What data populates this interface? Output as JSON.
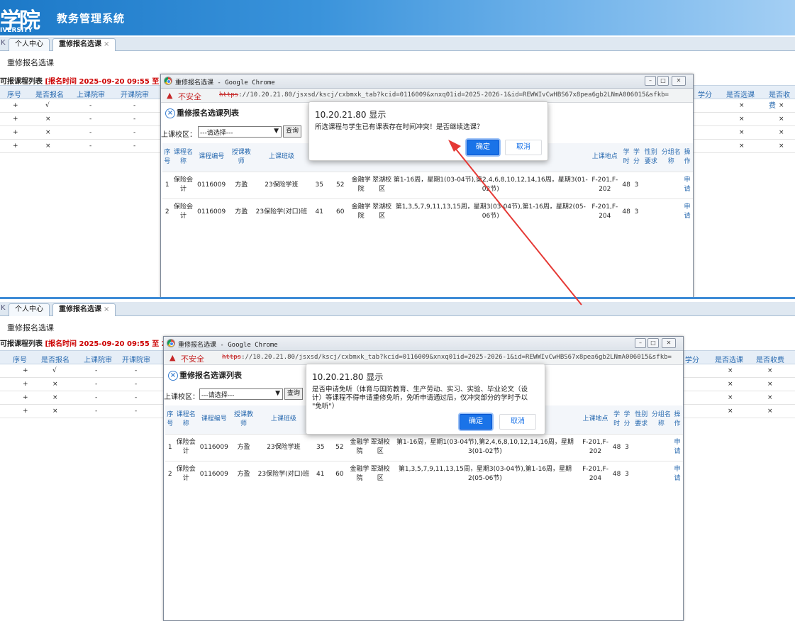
{
  "header": {
    "logo": "学院",
    "logo_sub": "IVERSITY",
    "system_title": "教务管理系统"
  },
  "tabs": {
    "arrow": "K",
    "personal": "个人中心",
    "current": "重修报名选课",
    "close": "×"
  },
  "page": {
    "section_title": "重修报名选课",
    "list_label": "可报课程列表",
    "time_label": "[报名时间 2025-09-20 09:55 至 2025"
  },
  "grid": {
    "headers_left": [
      "序号",
      "是否报名",
      "上课院审",
      "开课院审"
    ],
    "headers_right": [
      "学分",
      "是否选课",
      "是否收费"
    ],
    "rows": [
      {
        "no": "+",
        "apply": "√",
        "a": "-",
        "b": "-",
        "sel": "×",
        "fee": "×"
      },
      {
        "no": "+",
        "apply": "×",
        "a": "-",
        "b": "-",
        "sel": "×",
        "fee": "×"
      },
      {
        "no": "+",
        "apply": "×",
        "a": "-",
        "b": "-",
        "sel": "×",
        "fee": "×"
      },
      {
        "no": "+",
        "apply": "×",
        "a": "-",
        "b": "-",
        "sel": "×",
        "fee": "×"
      }
    ]
  },
  "popup": {
    "window_title": "重修报名选课 - Google Chrome",
    "insecure": "不安全",
    "url_proto": "https",
    "url_rest": "://10.20.21.80/jsxsd/kscj/cxbmxk_tab?kcid=0116009&xnxq01id=2025-2026-1&id=REWWIvCwHBS67x8pea6gb2LNmA006015&sfkb=",
    "list_title": "重修报名选课列表",
    "campus_label": "上课校区：",
    "campus_select": "---请选择---",
    "query_button": "查询",
    "minimize": "–",
    "maximize": "□",
    "close": "✕",
    "headers": {
      "seq": "序号",
      "name": "课程名称",
      "code": "课程编号",
      "teacher": "授课教师",
      "class": "上课班级",
      "col_a": "上课",
      "col_b": "数",
      "col_c": "数",
      "col_d": "系",
      "col_e": "区",
      "location": "上课地点",
      "hours": "学时",
      "credit": "学分",
      "gender": "性别要求",
      "group": "分组名称",
      "op": "操作"
    },
    "rows": [
      {
        "seq": "1",
        "name": "保险会计",
        "code": "0116009",
        "teacher": "方盈",
        "class": "23保险学班",
        "n1": "35",
        "n2": "52",
        "dept": "金融学院",
        "campus": "翠湖校区",
        "time": "第1-16周，星期1(03-04节),第2,4,6,8,10,12,14,16周，星期3(01-02节)",
        "loc": "F-201,F-202",
        "hours": "48",
        "credit": "3",
        "op": "申请"
      },
      {
        "seq": "2",
        "name": "保险会计",
        "code": "0116009",
        "teacher": "方盈",
        "class": "23保险学(对口)班",
        "n1": "41",
        "n2": "60",
        "dept": "金融学院",
        "campus": "翠湖校区",
        "time": "第1,3,5,7,9,11,13,15周，星期3(03-04节),第1-16周，星期2(05-06节)",
        "loc": "F-201,F-204",
        "hours": "48",
        "credit": "3",
        "op": "申请"
      }
    ]
  },
  "alert1": {
    "host": "10.20.21.80 显示",
    "message": "所选课程与学生已有课表存在时间冲突！是否继续选课？",
    "ok": "确定",
    "cancel": "取消"
  },
  "alert2": {
    "host": "10.20.21.80 显示",
    "message1": "是否申请免听（体育与国防教育、生产劳动、实习、实验、毕业论文（设",
    "message2": "计）等课程不得申请重修免听，免听申请通过后，仅冲突部分的学时予以",
    "message3": "\"免听\"）",
    "ok": "确定",
    "cancel": "取消"
  },
  "colors": {
    "header_blue": "#1c79c8",
    "arrow_red": "#e53935",
    "ok_blue": "#1a73e8"
  }
}
